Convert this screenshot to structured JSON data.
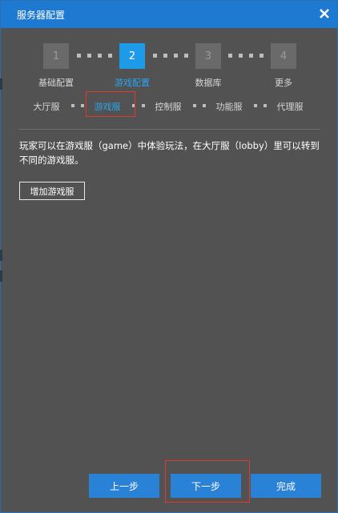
{
  "dialog": {
    "title": "服务器配置",
    "close_icon": "close-icon"
  },
  "steps": [
    {
      "number": "1",
      "label": "基础配置",
      "active": false
    },
    {
      "number": "2",
      "label": "游戏配置",
      "active": true
    },
    {
      "number": "3",
      "label": "数据库",
      "active": false
    },
    {
      "number": "4",
      "label": "更多",
      "active": false
    }
  ],
  "substeps": [
    {
      "label": "大厅服",
      "active": false
    },
    {
      "label": "游戏服",
      "active": true
    },
    {
      "label": "控制服",
      "active": false
    },
    {
      "label": "功能服",
      "active": false
    },
    {
      "label": "代理服",
      "active": false
    }
  ],
  "content": {
    "description": "玩家可以在游戏服（game）中体验玩法，在大厅服（lobby）里可以转到不同的游戏服。",
    "add_button": "增加游戏服"
  },
  "footer": {
    "prev_label": "上一步",
    "next_label": "下一步",
    "finish_label": "完成"
  },
  "colors": {
    "accent": "#1e9be8",
    "titlebar": "#1e7ad0",
    "panel": "#525252",
    "highlight": "#e03a2a"
  }
}
